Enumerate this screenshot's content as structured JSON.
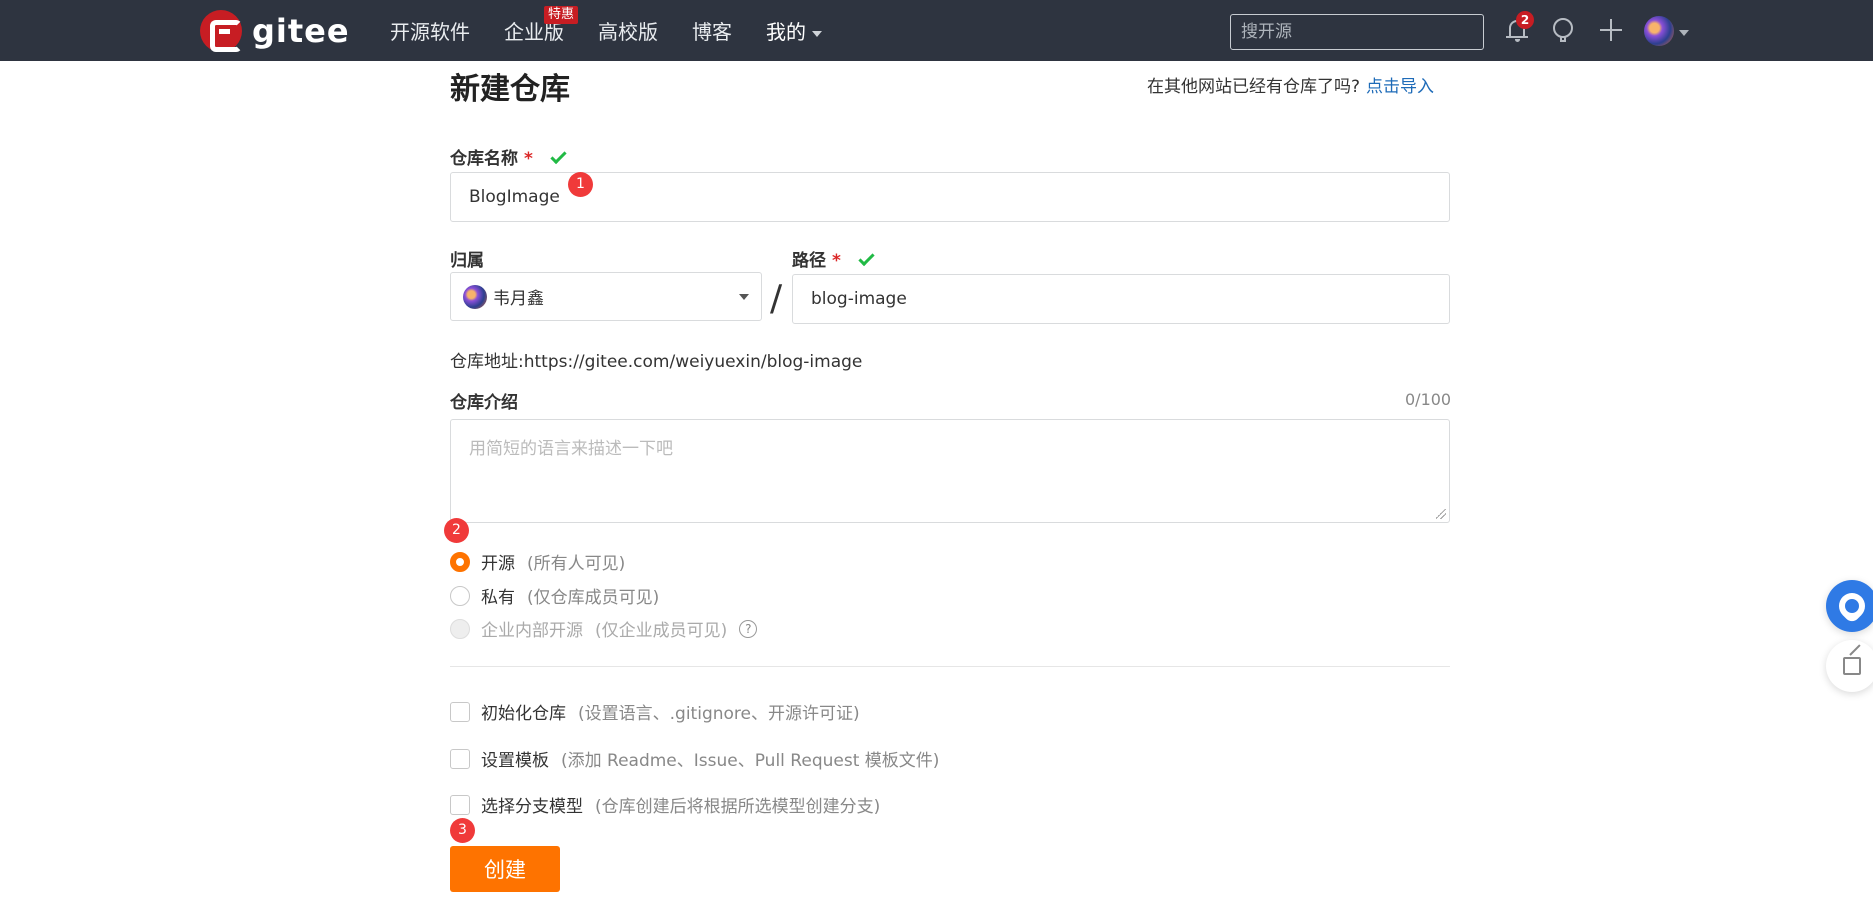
{
  "header": {
    "logo_text": "gitee",
    "nav": [
      {
        "label": "开源软件"
      },
      {
        "label": "企业版",
        "badge": "特惠"
      },
      {
        "label": "高校版"
      },
      {
        "label": "博客"
      },
      {
        "label": "我的"
      }
    ],
    "search_placeholder": "搜开源",
    "notification_count": "2",
    "icons": [
      "bell-icon",
      "bulb-icon",
      "plus-icon",
      "avatar",
      "chevron-down-icon"
    ]
  },
  "page": {
    "title": "新建仓库",
    "import_tip": "在其他网站已经有仓库了吗?",
    "import_link": "点击导入"
  },
  "form": {
    "name_label": "仓库名称",
    "required_mark": "*",
    "name_value": "BlogImage",
    "owner_label": "归属",
    "owner_value": "韦月鑫",
    "slash": "/",
    "path_label": "路径",
    "path_value": "blog-image",
    "repo_url": "仓库地址:https://gitee.com/weiyuexin/blog-image",
    "desc_label": "仓库介绍",
    "desc_counter": "0/100",
    "desc_placeholder": "用简短的语言来描述一下吧",
    "visibility": [
      {
        "label": "开源",
        "hint": "(所有人可见)",
        "selected": true
      },
      {
        "label": "私有",
        "hint": "(仅仓库成员可见)",
        "selected": false
      },
      {
        "label": "企业内部开源",
        "hint": "(仅企业成员可见)",
        "selected": false,
        "disabled": true
      }
    ],
    "help_icon": "?",
    "options": [
      {
        "label": "初始化仓库",
        "hint": "(设置语言、.gitignore、开源许可证)",
        "checked": false
      },
      {
        "label": "设置模板",
        "hint": "(添加 Readme、Issue、Pull Request 模板文件)",
        "checked": false
      },
      {
        "label": "选择分支模型",
        "hint": "(仓库创建后将根据所选模型创建分支)",
        "checked": false
      }
    ],
    "create_button": "创建"
  },
  "markers": [
    "1",
    "2",
    "3"
  ],
  "colors": {
    "topbar": "#2e3440",
    "accent": "#fe7300",
    "link": "#1e6bb8",
    "success": "#21ba45",
    "marker": "#f03a3a",
    "brand": "#c71d23"
  }
}
